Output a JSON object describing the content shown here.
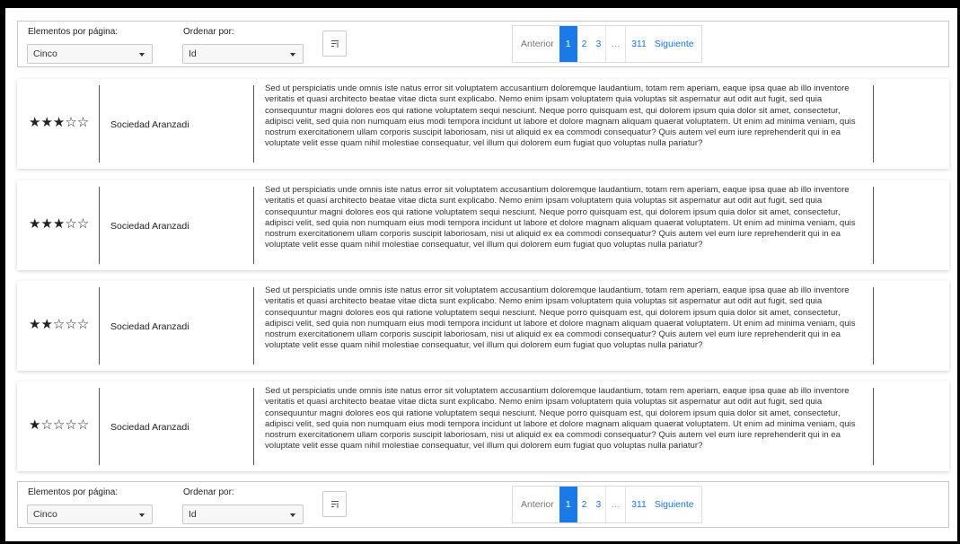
{
  "toolbar": {
    "items_per_page_label": "Elementos por página:",
    "items_per_page_value": "Cinco",
    "order_by_label": "Ordenar por:",
    "order_by_value": "Id",
    "pagination": {
      "prev": "Anterior",
      "pages": [
        "1",
        "2",
        "3"
      ],
      "ellipsis": "...",
      "last": "311",
      "next": "Siguiente",
      "active_page": "1"
    }
  },
  "reviews": [
    {
      "stars": "★★★☆☆",
      "rating": 3,
      "company": "Sociedad Aranzadi",
      "text": "Sed ut perspiciatis unde omnis iste natus error sit voluptatem accusantium doloremque laudantium, totam rem aperiam, eaque ipsa quae ab illo inventore veritatis et quasi architecto beatae vitae dicta sunt explicabo. Nemo enim ipsam voluptatem quia voluptas sit aspernatur aut odit aut fugit, sed quia consequuntur magni dolores eos qui ratione voluptatem sequi nesciunt. Neque porro quisquam est, qui dolorem ipsum quia dolor sit amet, consectetur, adipisci velit, sed quia non numquam eius modi tempora incidunt ut labore et dolore magnam aliquam quaerat voluptatem. Ut enim ad minima veniam, quis nostrum exercitationem ullam corporis suscipit laboriosam, nisi ut aliquid ex ea commodi consequatur? Quis autem vel eum iure reprehenderit qui in ea voluptate velit esse quam nihil molestiae consequatur, vel illum qui dolorem eum fugiat quo voluptas nulla pariatur?"
    },
    {
      "stars": "★★★☆☆",
      "rating": 3,
      "company": "Sociedad Aranzadi",
      "text": "Sed ut perspiciatis unde omnis iste natus error sit voluptatem accusantium doloremque laudantium, totam rem aperiam, eaque ipsa quae ab illo inventore veritatis et quasi architecto beatae vitae dicta sunt explicabo. Nemo enim ipsam voluptatem quia voluptas sit aspernatur aut odit aut fugit, sed quia consequuntur magni dolores eos qui ratione voluptatem sequi nesciunt. Neque porro quisquam est, qui dolorem ipsum quia dolor sit amet, consectetur, adipisci velit, sed quia non numquam eius modi tempora incidunt ut labore et dolore magnam aliquam quaerat voluptatem. Ut enim ad minima veniam, quis nostrum exercitationem ullam corporis suscipit laboriosam, nisi ut aliquid ex ea commodi consequatur? Quis autem vel eum iure reprehenderit qui in ea voluptate velit esse quam nihil molestiae consequatur, vel illum qui dolorem eum fugiat quo voluptas nulla pariatur?"
    },
    {
      "stars": "★★☆☆☆",
      "rating": 2,
      "company": "Sociedad Aranzadi",
      "text": "Sed ut perspiciatis unde omnis iste natus error sit voluptatem accusantium doloremque laudantium, totam rem aperiam, eaque ipsa quae ab illo inventore veritatis et quasi architecto beatae vitae dicta sunt explicabo. Nemo enim ipsam voluptatem quia voluptas sit aspernatur aut odit aut fugit, sed quia consequuntur magni dolores eos qui ratione voluptatem sequi nesciunt. Neque porro quisquam est, qui dolorem ipsum quia dolor sit amet, consectetur, adipisci velit, sed quia non numquam eius modi tempora incidunt ut labore et dolore magnam aliquam quaerat voluptatem. Ut enim ad minima veniam, quis nostrum exercitationem ullam corporis suscipit laboriosam, nisi ut aliquid ex ea commodi consequatur? Quis autem vel eum iure reprehenderit qui in ea voluptate velit esse quam nihil molestiae consequatur, vel illum qui dolorem eum fugiat quo voluptas nulla pariatur?"
    },
    {
      "stars": "★☆☆☆☆",
      "rating": 1,
      "company": "Sociedad Aranzadi",
      "text": "Sed ut perspiciatis unde omnis iste natus error sit voluptatem accusantium doloremque laudantium, totam rem aperiam, eaque ipsa quae ab illo inventore veritatis et quasi architecto beatae vitae dicta sunt explicabo. Nemo enim ipsam voluptatem quia voluptas sit aspernatur aut odit aut fugit, sed quia consequuntur magni dolores eos qui ratione voluptatem sequi nesciunt. Neque porro quisquam est, qui dolorem ipsum quia dolor sit amet, consectetur, adipisci velit, sed quia non numquam eius modi tempora incidunt ut labore et dolore magnam aliquam quaerat voluptatem. Ut enim ad minima veniam, quis nostrum exercitationem ullam corporis suscipit laboriosam, nisi ut aliquid ex ea commodi consequatur? Quis autem vel eum iure reprehenderit qui in ea voluptate velit esse quam nihil molestiae consequatur, vel illum qui dolorem eum fugiat quo voluptas nulla pariatur?"
    }
  ],
  "colors": {
    "accent": "#1a7be8",
    "frame": "#000000",
    "border": "#c7c7c7"
  },
  "icons": {
    "sort": "sort-icon",
    "dropdown": "chevron-down-icon",
    "star": "star-icon"
  }
}
